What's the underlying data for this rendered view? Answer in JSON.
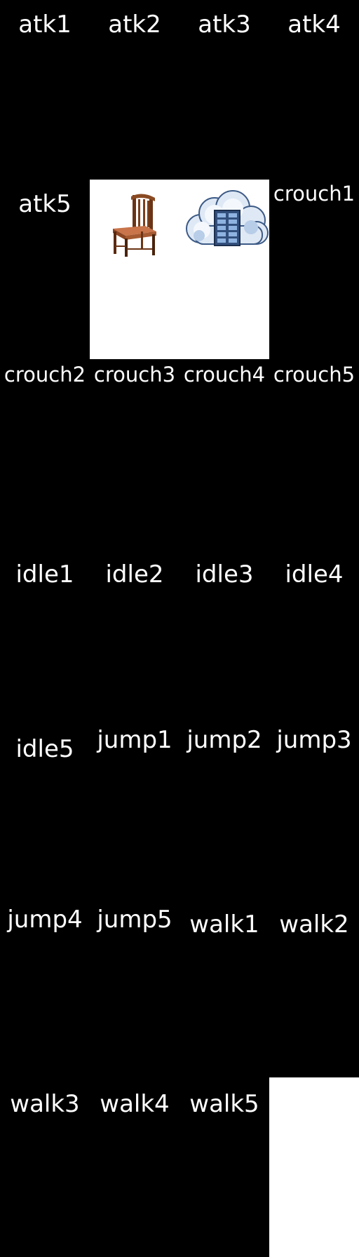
{
  "sheet": {
    "background": "#000000",
    "label_color": "#ffffff",
    "frames": [
      {
        "label": "atk1"
      },
      {
        "label": "atk2"
      },
      {
        "label": "atk3"
      },
      {
        "label": "atk4"
      },
      {
        "label": "atk5"
      },
      {
        "label": "",
        "content": "chair-icon"
      },
      {
        "label": "",
        "content": "cloud-server-icon"
      },
      {
        "label": "crouch1"
      },
      {
        "label": "crouch2"
      },
      {
        "label": "crouch3"
      },
      {
        "label": "crouch4"
      },
      {
        "label": "crouch5"
      },
      {
        "label": "idle1"
      },
      {
        "label": "idle2"
      },
      {
        "label": "idle3"
      },
      {
        "label": "idle4"
      },
      {
        "label": "idle5"
      },
      {
        "label": "jump1"
      },
      {
        "label": "jump2"
      },
      {
        "label": "jump3"
      },
      {
        "label": "jump4"
      },
      {
        "label": "jump5"
      },
      {
        "label": "walk1"
      },
      {
        "label": "walk2"
      },
      {
        "label": "walk3"
      },
      {
        "label": "walk4"
      },
      {
        "label": "walk5"
      },
      {
        "label": "",
        "content": "empty-white"
      }
    ]
  }
}
